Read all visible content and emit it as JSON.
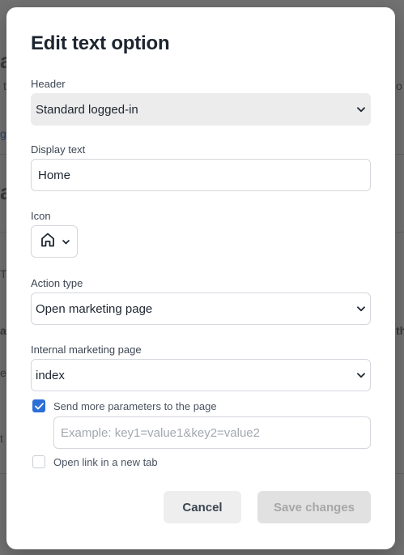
{
  "modal": {
    "title": "Edit text option",
    "header": {
      "label": "Header",
      "value": "Standard logged-in"
    },
    "display_text": {
      "label": "Display text",
      "value": "Home"
    },
    "icon": {
      "label": "Icon",
      "selected_icon": "home-icon"
    },
    "action_type": {
      "label": "Action type",
      "value": "Open marketing page"
    },
    "marketing_page": {
      "label": "Internal marketing page",
      "value": "index"
    },
    "send_params": {
      "label": "Send more parameters to the page",
      "checked": true,
      "placeholder": "Example: key1=value1&key2=value2"
    },
    "new_tab": {
      "label": "Open link in a new tab",
      "checked": false
    },
    "buttons": {
      "cancel": "Cancel",
      "save": "Save changes"
    }
  },
  "colors": {
    "accent": "#2b6fd6",
    "title": "#1d2530",
    "disabled_button": "#e1e1e1"
  }
}
